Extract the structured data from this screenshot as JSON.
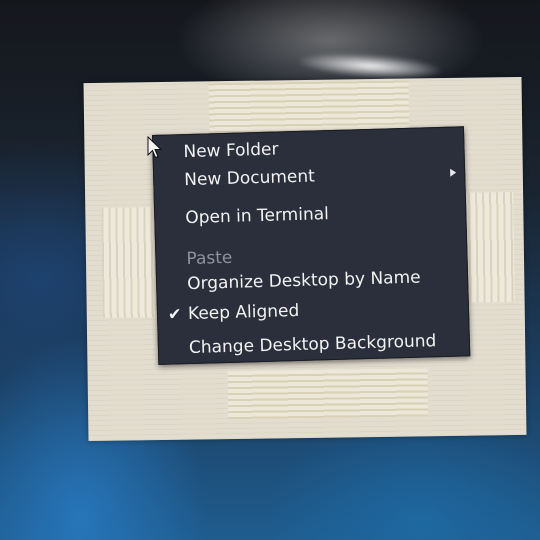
{
  "desktop": {
    "background_colors": {
      "top": "#15171c",
      "middle": "#1c3f62",
      "bottom": "#1f5d8f",
      "panel": "#e3ddd0"
    }
  },
  "context_menu": {
    "background_color": "#2b2f3b",
    "text_color": "#f2f2f2",
    "disabled_color": "#8e929c",
    "items": [
      {
        "label": "New Folder",
        "enabled": true
      },
      {
        "label": "New Document",
        "enabled": true,
        "has_submenu": true,
        "submenu_icon": "chevron-right-icon"
      },
      {
        "label": "Open in Terminal",
        "enabled": true
      },
      {
        "label": "Paste",
        "enabled": false
      },
      {
        "label": "Organize Desktop by Name",
        "enabled": true
      },
      {
        "label": "Keep Aligned",
        "enabled": true,
        "checked": true,
        "check_icon": "checkmark-icon",
        "check_glyph": "✔"
      },
      {
        "label": "Change Desktop Background",
        "enabled": true
      }
    ]
  },
  "cursor": {
    "icon": "mouse-pointer-icon"
  }
}
